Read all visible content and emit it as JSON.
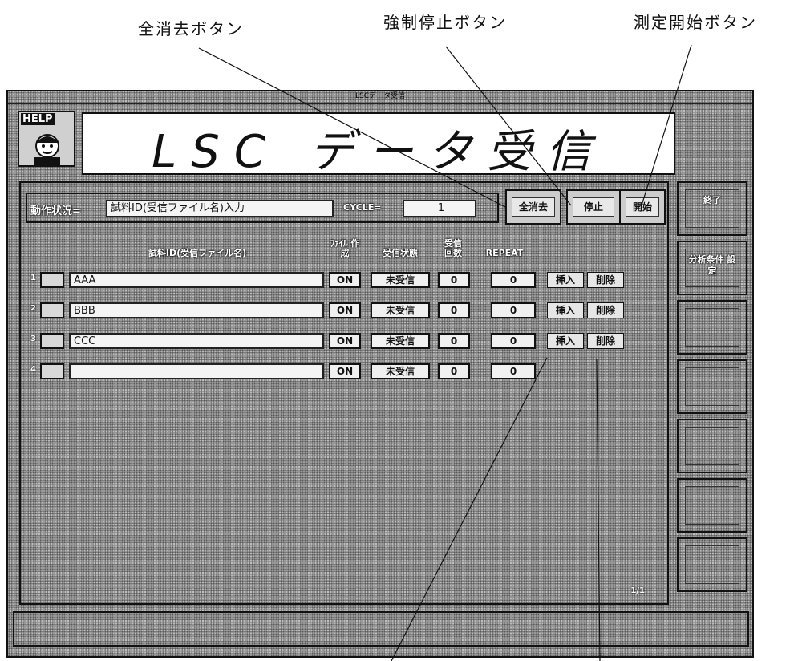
{
  "callouts": {
    "clear_all": "全消去ボタン",
    "force_stop": "強制停止ボタン",
    "start": "測定開始ボタン"
  },
  "window": {
    "titlebar": "LSCデータ受信",
    "help_label": "HELP",
    "title": "LSC データ受信"
  },
  "status": {
    "label": "動作状況=",
    "value": "試料ID(受信ファイル名)入力",
    "cycle_label": "CYCLE=",
    "cycle_value": "1"
  },
  "toolbar": {
    "clear_all": "全消去",
    "stop": "停止",
    "start": "開始"
  },
  "side_buttons": [
    {
      "label": "終了"
    },
    {
      "label": "分析条件 設定"
    },
    {
      "label": ""
    },
    {
      "label": ""
    },
    {
      "label": ""
    },
    {
      "label": ""
    },
    {
      "label": ""
    }
  ],
  "table": {
    "headers": {
      "sample_id": "試料ID(受信ファイル名)",
      "file_create": "ﾌｧｲﾙ 作成",
      "recv_status": "受信状態",
      "recv_count": "受信 回数",
      "repeat": "REPEAT"
    },
    "insert_label": "挿入",
    "delete_label": "削除",
    "rows": [
      {
        "num": "1",
        "sample_id": "AAA",
        "file": "ON",
        "status": "未受信",
        "count": "0",
        "repeat": "0",
        "has_actions": true
      },
      {
        "num": "2",
        "sample_id": "BBB",
        "file": "ON",
        "status": "未受信",
        "count": "0",
        "repeat": "0",
        "has_actions": true
      },
      {
        "num": "3",
        "sample_id": "CCC",
        "file": "ON",
        "status": "未受信",
        "count": "0",
        "repeat": "0",
        "has_actions": true
      },
      {
        "num": "4",
        "sample_id": "",
        "file": "ON",
        "status": "未受信",
        "count": "0",
        "repeat": "0",
        "has_actions": false
      }
    ],
    "page_indicator": "1/1"
  }
}
